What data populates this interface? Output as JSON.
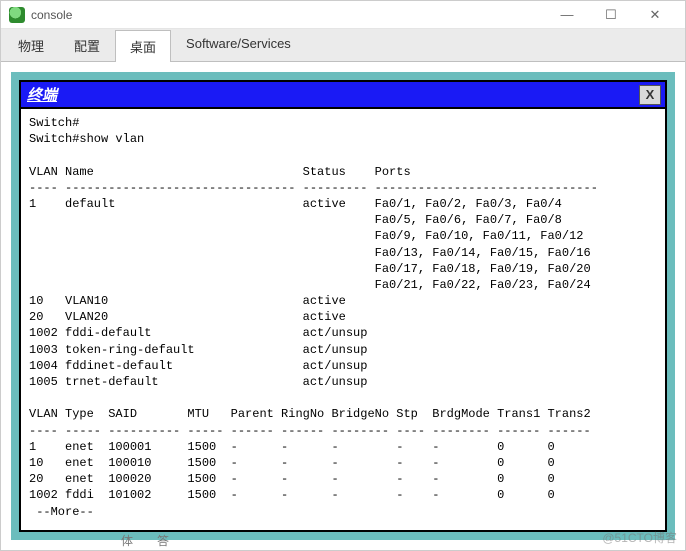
{
  "window": {
    "title": "console",
    "controls": {
      "min": "—",
      "max": "☐",
      "close": "✕"
    }
  },
  "tabs": [
    {
      "label": "物理",
      "active": false
    },
    {
      "label": "配置",
      "active": false
    },
    {
      "label": "桌面",
      "active": true
    },
    {
      "label": "Software/Services",
      "active": false
    }
  ],
  "terminal": {
    "title": "终端",
    "close_label": "X",
    "prompt1": "Switch#",
    "prompt2": "Switch#show vlan",
    "header1": "VLAN Name                             Status    Ports",
    "divider1": "---- -------------------------------- --------- -------------------------------",
    "vlan_rows": [
      "1    default                          active    Fa0/1, Fa0/2, Fa0/3, Fa0/4",
      "                                                Fa0/5, Fa0/6, Fa0/7, Fa0/8",
      "                                                Fa0/9, Fa0/10, Fa0/11, Fa0/12",
      "                                                Fa0/13, Fa0/14, Fa0/15, Fa0/16",
      "                                                Fa0/17, Fa0/18, Fa0/19, Fa0/20",
      "                                                Fa0/21, Fa0/22, Fa0/23, Fa0/24",
      "10   VLAN10                           active",
      "20   VLAN20                           active",
      "1002 fddi-default                     act/unsup",
      "1003 token-ring-default               act/unsup",
      "1004 fddinet-default                  act/unsup",
      "1005 trnet-default                    act/unsup"
    ],
    "header2": "VLAN Type  SAID       MTU   Parent RingNo BridgeNo Stp  BrdgMode Trans1 Trans2",
    "divider2": "---- ----- ---------- ----- ------ ------ -------- ---- -------- ------ ------",
    "detail_rows": [
      "1    enet  100001     1500  -      -      -        -    -        0      0",
      "10   enet  100010     1500  -      -      -        -    -        0      0",
      "20   enet  100020     1500  -      -      -        -    -        0      0",
      "1002 fddi  101002     1500  -      -      -        -    -        0      0"
    ],
    "more": " --More--"
  },
  "watermark": "@51CTO博客",
  "bottom_strip": {
    "a": "体",
    "b": "答"
  }
}
